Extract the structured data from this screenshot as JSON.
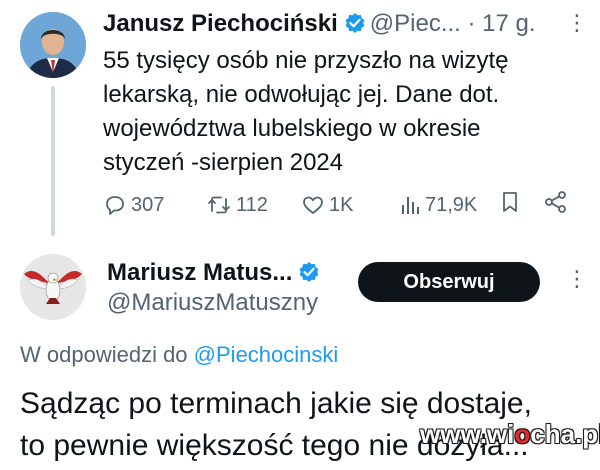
{
  "tweet1": {
    "author_name": "Janusz Piechociński",
    "handle_time": "@Piec... · 17 g.",
    "text_lines": [
      "55 tysięcy osób nie przyszło na wizytę",
      "lekarską, nie odwołując jej. Dane dot.",
      "województwa lubelskiego w okresie",
      "styczeń -sierpien 2024"
    ],
    "more_label": "⋮",
    "stats": {
      "replies": "307",
      "reposts": "112",
      "likes": "1K",
      "views": "71,9K"
    }
  },
  "tweet2": {
    "author_name": "Mariusz Matus...",
    "handle": "@MariuszMatuszny",
    "follow_label": "Obserwuj",
    "more_label": "⋮",
    "reply_prefix": "W odpowiedzi do",
    "reply_handle": "@Piechocinski",
    "text_lines": [
      "Sądząc po terminach jakie się dostaje,",
      "to pewnie większość tego nie dożyła..."
    ]
  },
  "watermark": {
    "part1": "www.wi",
    "part2": "o",
    "part3": "cha.pl"
  },
  "colors": {
    "verified": "#1d9bf0",
    "muted": "#536471",
    "text": "#0f1419",
    "link": "#1d9bf0",
    "follow_bg": "#0f1419"
  },
  "icons": [
    "reply-icon",
    "repost-icon",
    "like-icon",
    "views-icon",
    "bookmark-icon",
    "share-icon",
    "verified-badge-icon",
    "more-options-icon"
  ]
}
